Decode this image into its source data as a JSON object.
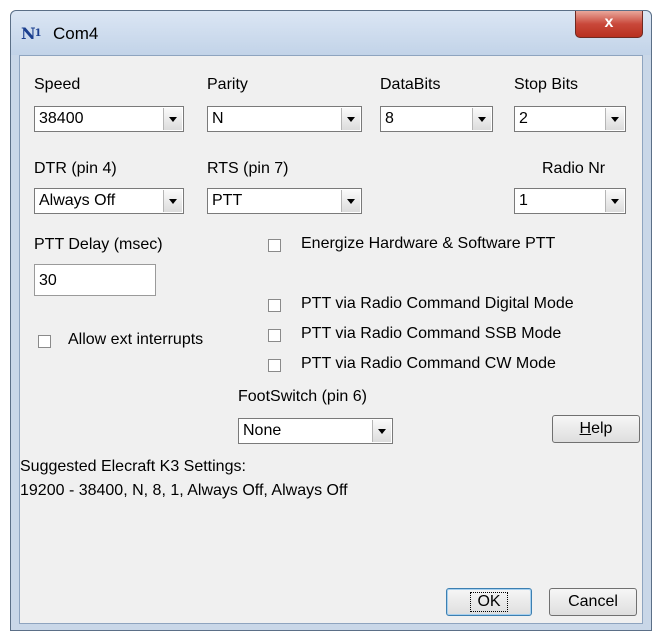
{
  "window": {
    "title": "Com4",
    "close_glyph": "x",
    "icon": "n1mm-logo-icon"
  },
  "speed": {
    "label": "Speed",
    "value": "38400"
  },
  "parity": {
    "label": "Parity",
    "value": "N"
  },
  "databits": {
    "label": "DataBits",
    "value": "8"
  },
  "stopbits": {
    "label": "Stop Bits",
    "value": "2"
  },
  "dtr": {
    "label": "DTR (pin 4)",
    "value": "Always Off"
  },
  "rts": {
    "label": "RTS (pin 7)",
    "value": "PTT"
  },
  "radio_nr": {
    "label": "Radio Nr",
    "value": "1"
  },
  "ptt_delay": {
    "label": "PTT Delay  (msec)",
    "value": "30"
  },
  "checkboxes": {
    "energize": {
      "label": "Energize Hardware & Software PTT",
      "checked": false
    },
    "digital": {
      "label": "PTT via Radio Command Digital Mode",
      "checked": false
    },
    "ssb": {
      "label": "PTT via Radio Command SSB Mode",
      "checked": false
    },
    "cw": {
      "label": "PTT via Radio Command CW Mode",
      "checked": false
    },
    "ext_interrupts": {
      "label": "Allow ext interrupts",
      "checked": false
    }
  },
  "footswitch": {
    "label": "FootSwitch (pin 6)",
    "value": "None"
  },
  "buttons": {
    "help_first": "H",
    "help_rest": "elp",
    "ok": "OK",
    "cancel": "Cancel"
  },
  "suggested": {
    "line1": "Suggested Elecraft K3 Settings:",
    "line2": "19200 - 38400, N, 8, 1, Always Off, Always Off"
  }
}
